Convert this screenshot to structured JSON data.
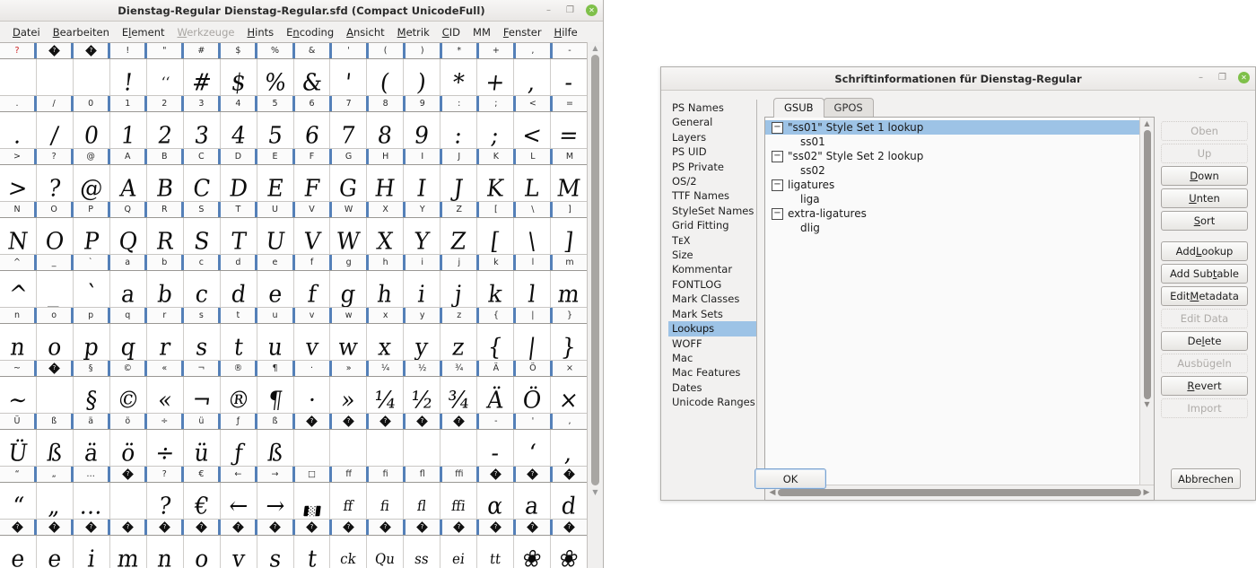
{
  "main_window": {
    "title": "Dienstag-Regular  Dienstag-Regular.sfd (Compact UnicodeFull)",
    "window_controls": [
      {
        "name": "minimize",
        "glyph": "–"
      },
      {
        "name": "maximize",
        "glyph": "❐"
      },
      {
        "name": "close",
        "glyph": "✕"
      }
    ],
    "menu": [
      {
        "label": "Datei",
        "mnemonic": "D",
        "disabled": false
      },
      {
        "label": "Bearbeiten",
        "mnemonic": "B",
        "disabled": false
      },
      {
        "label": "Element",
        "mnemonic": "l",
        "disabled": false
      },
      {
        "label": "Werkzeuge",
        "mnemonic": "W",
        "disabled": true
      },
      {
        "label": "Hints",
        "mnemonic": "H",
        "disabled": false
      },
      {
        "label": "Encoding",
        "mnemonic": "n",
        "disabled": false
      },
      {
        "label": "Ansicht",
        "mnemonic": "A",
        "disabled": false
      },
      {
        "label": "Metrik",
        "mnemonic": "M",
        "disabled": false
      },
      {
        "label": "CID",
        "mnemonic": "C",
        "disabled": false
      },
      {
        "label": "MM",
        "mnemonic": "",
        "disabled": false
      },
      {
        "label": "Fenster",
        "mnemonic": "F",
        "disabled": false
      },
      {
        "label": "Hilfe",
        "mnemonic": "H",
        "disabled": false
      }
    ]
  },
  "fontgrid": {
    "columns": 16,
    "rows": [
      {
        "labels": [
          "?",
          "◆",
          "◆",
          "!",
          "\"",
          "#",
          "$",
          "%",
          "&",
          "'",
          "(",
          ")",
          "*",
          "+",
          ",",
          "-"
        ],
        "label_flags": [
          "red",
          "nb",
          "nb",
          "",
          "",
          "",
          "",
          "",
          "",
          "",
          "",
          "",
          "",
          "",
          "",
          ""
        ],
        "glyphs": [
          "",
          "",
          "",
          "!",
          "‘‘",
          "#",
          "$",
          "%",
          "&",
          "'",
          "(",
          ")",
          "*",
          "+",
          ",",
          "-"
        ]
      },
      {
        "labels": [
          ".",
          "/",
          "0",
          "1",
          "2",
          "3",
          "4",
          "5",
          "6",
          "7",
          "8",
          "9",
          ":",
          ";",
          "<",
          "="
        ],
        "label_flags": [
          "",
          "",
          "",
          "",
          "",
          "",
          "",
          "",
          "",
          "",
          "",
          "",
          "",
          "",
          "",
          ""
        ],
        "glyphs": [
          ".",
          "/",
          "0",
          "1",
          "2",
          "3",
          "4",
          "5",
          "6",
          "7",
          "8",
          "9",
          ":",
          ";",
          "<",
          "="
        ]
      },
      {
        "labels": [
          ">",
          "?",
          "@",
          "A",
          "B",
          "C",
          "D",
          "E",
          "F",
          "G",
          "H",
          "I",
          "J",
          "K",
          "L",
          "M"
        ],
        "label_flags": [
          "",
          "",
          "",
          "",
          "",
          "",
          "",
          "",
          "",
          "",
          "",
          "",
          "",
          "",
          "",
          ""
        ],
        "glyphs": [
          ">",
          "?",
          "@",
          "A",
          "B",
          "C",
          "D",
          "E",
          "F",
          "G",
          "H",
          "I",
          "J",
          "K",
          "L",
          "M"
        ]
      },
      {
        "labels": [
          "N",
          "O",
          "P",
          "Q",
          "R",
          "S",
          "T",
          "U",
          "V",
          "W",
          "X",
          "Y",
          "Z",
          "[",
          "\\",
          "]"
        ],
        "label_flags": [
          "",
          "",
          "",
          "",
          "",
          "",
          "",
          "",
          "",
          "",
          "",
          "",
          "",
          "",
          "",
          ""
        ],
        "glyphs": [
          "N",
          "O",
          "P",
          "Q",
          "R",
          "S",
          "T",
          "U",
          "V",
          "W",
          "X",
          "Y",
          "Z",
          "[",
          "\\",
          "]"
        ]
      },
      {
        "labels": [
          "^",
          "_",
          "`",
          "a",
          "b",
          "c",
          "d",
          "e",
          "f",
          "g",
          "h",
          "i",
          "j",
          "k",
          "l",
          "m"
        ],
        "label_flags": [
          "",
          "",
          "",
          "",
          "",
          "",
          "",
          "",
          "",
          "",
          "",
          "",
          "",
          "",
          "",
          ""
        ],
        "glyphs": [
          "^",
          "_",
          "`",
          "a",
          "b",
          "c",
          "d",
          "e",
          "f",
          "g",
          "h",
          "i",
          "j",
          "k",
          "l",
          "m"
        ]
      },
      {
        "labels": [
          "n",
          "o",
          "p",
          "q",
          "r",
          "s",
          "t",
          "u",
          "v",
          "w",
          "x",
          "y",
          "z",
          "{",
          "|",
          "}"
        ],
        "label_flags": [
          "",
          "",
          "",
          "",
          "",
          "",
          "",
          "",
          "",
          "",
          "",
          "",
          "",
          "",
          "",
          ""
        ],
        "glyphs": [
          "n",
          "o",
          "p",
          "q",
          "r",
          "s",
          "t",
          "u",
          "v",
          "w",
          "x",
          "y",
          "z",
          "{",
          "|",
          "}"
        ]
      },
      {
        "labels": [
          "~",
          "◆",
          "§",
          "©",
          "«",
          "¬",
          "®",
          "¶",
          "·",
          "»",
          "¼",
          "½",
          "¾",
          "Ä",
          "Ö",
          "×"
        ],
        "label_flags": [
          "",
          "nb",
          "",
          "",
          "",
          "",
          "",
          "",
          "",
          "",
          "",
          "",
          "",
          "",
          "",
          ""
        ],
        "glyphs": [
          "~",
          "",
          "§",
          "©",
          "«",
          "¬",
          "®",
          "¶",
          "·",
          "»",
          "¼",
          "½",
          "¾",
          "Ä",
          "Ö",
          "×"
        ]
      },
      {
        "labels": [
          "Ü",
          "ß",
          "ä",
          "ö",
          "÷",
          "ü",
          "ƒ",
          "ß",
          "◆",
          "◆",
          "◆",
          "◆",
          "◆",
          "-",
          "'",
          ","
        ],
        "label_flags": [
          "",
          "",
          "",
          "",
          "",
          "",
          "",
          "",
          "nb",
          "nb",
          "nb",
          "nb",
          "nb",
          "",
          "",
          ""
        ],
        "glyphs": [
          "Ü",
          "ß",
          "ä",
          "ö",
          "÷",
          "ü",
          "ƒ",
          "ß",
          "",
          "",
          "",
          "",
          "",
          "-",
          "‘",
          ","
        ]
      },
      {
        "labels": [
          "“",
          "„",
          "…",
          "◆",
          "?",
          "€",
          "←",
          "→",
          "□",
          "ff",
          "fi",
          "fl",
          "ffi",
          "◆",
          "◆",
          "◆"
        ],
        "label_flags": [
          "",
          "",
          "",
          "nb",
          "",
          "",
          "",
          "",
          "",
          "",
          "",
          "",
          "",
          "nb",
          "nb",
          "nb"
        ],
        "glyphs": [
          "“",
          "„",
          "…",
          "",
          "?",
          "€",
          "←",
          "→",
          "▓",
          "ff",
          "fi",
          "fl",
          "ffi",
          "α",
          "a",
          "d"
        ]
      },
      {
        "labels": [
          "◆",
          "◆",
          "◆",
          "◆",
          "◆",
          "◆",
          "◆",
          "◆",
          "◆",
          "◆",
          "◆",
          "◆",
          "◆",
          "◆",
          "◆",
          "◆"
        ],
        "label_flags": [
          "nb",
          "nb",
          "nb",
          "nb",
          "nb",
          "nb",
          "nb",
          "nb",
          "nb",
          "nb",
          "nb",
          "nb",
          "nb",
          "nb",
          "nb",
          "nb"
        ],
        "glyphs": [
          "e",
          "e",
          "i",
          "m",
          "n",
          "o",
          "v",
          "s",
          "t",
          "ck",
          "Qu",
          "ss",
          "ei",
          "tt",
          "❀",
          "❀"
        ]
      }
    ]
  },
  "dialog": {
    "title": "Schriftinformationen für Dienstag-Regular",
    "window_controls": [
      {
        "name": "minimize",
        "glyph": "–"
      },
      {
        "name": "maximize",
        "glyph": "❐"
      },
      {
        "name": "close",
        "glyph": "✕"
      }
    ],
    "sidebar": {
      "selected": "Lookups",
      "items": [
        {
          "label": "PS Names"
        },
        {
          "label": "General"
        },
        {
          "label": "Layers"
        },
        {
          "label": "PS UID"
        },
        {
          "label": "PS Private"
        },
        {
          "label": "OS/2"
        },
        {
          "label": "TTF Names"
        },
        {
          "label": "StyleSet Names"
        },
        {
          "label": "Grid Fitting"
        },
        {
          "label": "TᴇX"
        },
        {
          "label": "Size"
        },
        {
          "label": "Kommentar"
        },
        {
          "label": "FONTLOG"
        },
        {
          "label": "Mark Classes"
        },
        {
          "label": "Mark Sets"
        },
        {
          "label": "Lookups"
        },
        {
          "label": "WOFF"
        },
        {
          "label": "Mac"
        },
        {
          "label": "Mac Features"
        },
        {
          "label": "Dates"
        },
        {
          "label": "Unicode Ranges"
        }
      ]
    },
    "tabs": [
      {
        "label": "GSUB",
        "active": true
      },
      {
        "label": "GPOS",
        "active": false
      }
    ],
    "lookup_tree": [
      {
        "label": "\"ss01\" Style Set 1 lookup",
        "level": 0,
        "expanded": true,
        "selected": true
      },
      {
        "label": "ss01",
        "level": 1,
        "expanded": false,
        "selected": false
      },
      {
        "label": "\"ss02\" Style Set 2 lookup",
        "level": 0,
        "expanded": true,
        "selected": false
      },
      {
        "label": "ss02",
        "level": 1,
        "expanded": false,
        "selected": false
      },
      {
        "label": "ligatures",
        "level": 0,
        "expanded": true,
        "selected": false
      },
      {
        "label": "liga",
        "level": 1,
        "expanded": false,
        "selected": false
      },
      {
        "label": "extra-ligatures",
        "level": 0,
        "expanded": true,
        "selected": false
      },
      {
        "label": "dlig",
        "level": 1,
        "expanded": false,
        "selected": false
      }
    ],
    "action_buttons": [
      {
        "label": "Oben",
        "mnemonic": "",
        "disabled": true,
        "gap_after": false
      },
      {
        "label": "Up",
        "mnemonic": "",
        "disabled": true,
        "gap_after": false
      },
      {
        "label": "Down",
        "mnemonic": "D",
        "disabled": false,
        "gap_after": false
      },
      {
        "label": "Unten",
        "mnemonic": "U",
        "disabled": false,
        "gap_after": false
      },
      {
        "label": "Sort",
        "mnemonic": "S",
        "disabled": false,
        "gap_after": true
      },
      {
        "label": "Add Lookup",
        "mnemonic": "L",
        "disabled": false,
        "gap_after": false
      },
      {
        "label": "Add Subtable",
        "mnemonic": "t",
        "disabled": false,
        "gap_after": false
      },
      {
        "label": "Edit Metadata",
        "mnemonic": "M",
        "disabled": false,
        "gap_after": false
      },
      {
        "label": "Edit Data",
        "mnemonic": "",
        "disabled": true,
        "gap_after": false
      },
      {
        "label": "Delete",
        "mnemonic": "l",
        "disabled": false,
        "gap_after": false
      },
      {
        "label": "Ausbügeln",
        "mnemonic": "",
        "disabled": true,
        "gap_after": false
      },
      {
        "label": "Revert",
        "mnemonic": "R",
        "disabled": false,
        "gap_after": false
      },
      {
        "label": "Import",
        "mnemonic": "",
        "disabled": true,
        "gap_after": false
      }
    ],
    "ok_label": "OK",
    "cancel_label": "Abbrechen"
  },
  "colors": {
    "selection": "#9dc3e6",
    "header_tick": "#5480b8",
    "close_button": "#7fc04a",
    "window_bg": "#f2f1f0"
  }
}
